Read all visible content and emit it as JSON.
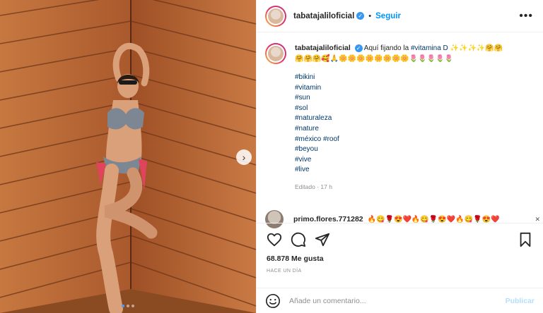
{
  "header": {
    "username": "tabatajaliloficial",
    "separator": "•",
    "follow_label": "Seguir",
    "more_icon": "more-horizontal-icon"
  },
  "caption": {
    "username": "tabatajaliloficial",
    "text_before_tag": "Aquí fijando la",
    "tag": "#vitamina D",
    "emojis_line1": "✨✨✨✨🤗🤗",
    "emojis_line2": "🤗🤗🤗🥰🙏🌼🌼🌼🌼🌼🌼🌼🌼🌷🌷🌷🌷🌷",
    "hashtags": [
      "#bikini",
      "#vitamin",
      "#sun",
      "#sol",
      "#naturaleza",
      "#nature",
      "#méxico #roof",
      "#beyou",
      "#vive",
      "#live"
    ],
    "edited": "Editado · 17 h"
  },
  "comment": {
    "username": "primo.flores.771282",
    "text": "🔥😋🌹😍❤️🔥😋🌹😍❤️🔥😋🌹😍❤️"
  },
  "actions": {
    "likes": "68.878 Me gusta",
    "when": "HACE UN DÍA"
  },
  "add_comment": {
    "placeholder": "Añade un comentario...",
    "publish_label": "Publicar"
  },
  "colors": {
    "link": "#0095f6",
    "hashtag": "#00376b",
    "wood": "#b86a3a"
  },
  "carousel": {
    "current": 1,
    "total": 3
  }
}
